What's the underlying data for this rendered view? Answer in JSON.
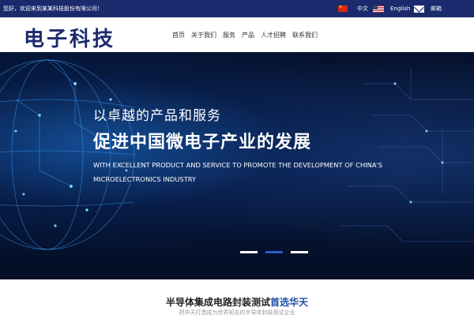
{
  "topbar": {
    "welcome": "您好，欢迎来到某某科技股份有限公司！",
    "lang_cn": "中文",
    "lang_en": "English",
    "mail": "邮箱",
    "bg_color": "#1a2a6c"
  },
  "header": {
    "logo": "电子科技",
    "nav": [
      "首页",
      "关于我们",
      "服务",
      "产品",
      "人才招聘",
      "联系我们"
    ]
  },
  "hero": {
    "line1": "以卓越的产品和服务",
    "line2": "促进中国微电子产业的发展",
    "english": "WITH EXCELLENT PRODUCT AND SERVICE TO PROMOTE THE DEVELOPMENT OF CHINA'S MICROELECTRONICS INDUSTRY",
    "slides": 3,
    "active_slide": 2
  },
  "section": {
    "title_main": "半导体集成电路封装测试",
    "title_highlight": "首选华天",
    "subtitle": "把华天打造成为世界知名的半导体封装测试企业",
    "accent_color": "#1c4ea3"
  }
}
